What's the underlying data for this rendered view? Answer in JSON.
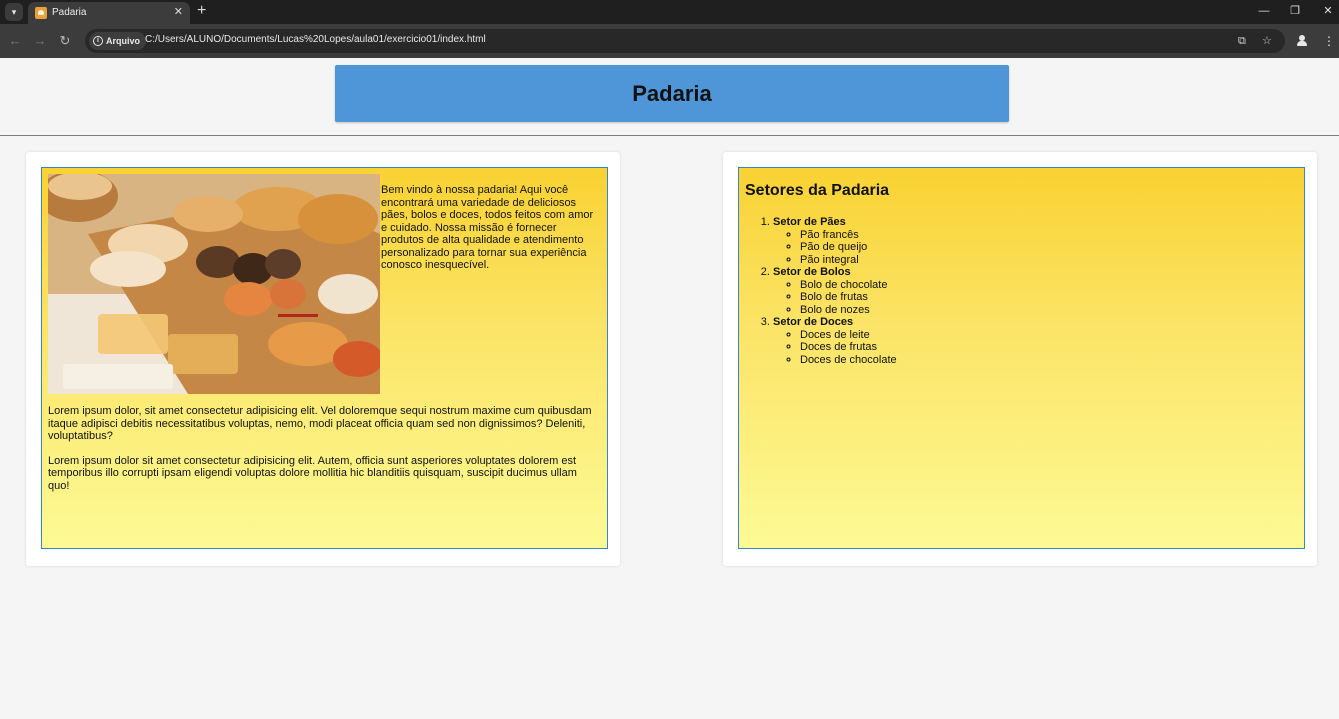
{
  "browser": {
    "tab": {
      "title": "Padaria"
    },
    "address": {
      "chip_label": "Arquivo",
      "url": "C:/Users/ALUNO/Documents/Lucas%20Lopes/aula01/exercicio01/index.html"
    }
  },
  "header": {
    "title": "Padaria"
  },
  "left_card": {
    "welcome_text": "Bem vindo à nossa padaria! Aqui você encontrará uma variedade de deliciosos pães, bolos e doces, todos feitos com amor e cuidado. Nossa missão é fornecer produtos de alta qualidade e atendimento personalizado para tornar sua experiência conosco inesquecível.",
    "paragraph_1": "Lorem ipsum dolor, sit amet consectetur adipisicing elit. Vel doloremque sequi nostrum maxime cum quibusdam itaque adipisci debitis necessitatibus voluptas, nemo, modi placeat officia quam sed non dignissimos? Deleniti, voluptatibus?",
    "paragraph_2": "Lorem ipsum dolor sit amet consectetur adipisicing elit. Autem, officia sunt asperiores voluptates dolorem est temporibus illo corrupti ipsam eligendi voluptas dolore mollitia hic blanditiis quisquam, suscipit ducimus ullam quo!"
  },
  "right_card": {
    "title": "Setores da Padaria",
    "sectors": [
      {
        "name": "Setor de Pães",
        "items": [
          "Pão francês",
          "Pão de queijo",
          "Pão integral"
        ]
      },
      {
        "name": "Setor de Bolos",
        "items": [
          "Bolo de chocolate",
          "Bolo de frutas",
          "Bolo de nozes"
        ]
      },
      {
        "name": "Setor de Doces",
        "items": [
          "Doces de leite",
          "Doces de frutas",
          "Doces de chocolate"
        ]
      }
    ]
  },
  "colors": {
    "header_bg": "#4f96d9",
    "card_gradient_top": "#f9d232",
    "card_gradient_bottom": "#fdfa95",
    "card_border": "#3b83c8"
  }
}
